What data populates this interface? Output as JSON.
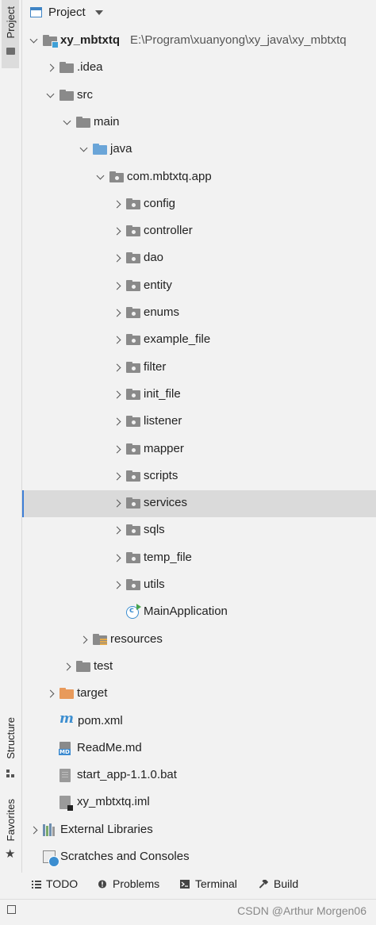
{
  "left_strip": {
    "project_tab": "Project",
    "structure_tab": "Structure",
    "favorites_tab": "Favorites"
  },
  "header": {
    "title": "Project"
  },
  "tree": [
    {
      "label": "xy_mbtxtq",
      "bold": true,
      "path": "E:\\Program\\xuanyong\\xy_java\\xy_mbtxtq",
      "arrow": "down",
      "icon": "module-folder-icon",
      "depth": 0
    },
    {
      "label": ".idea",
      "arrow": "right",
      "icon": "folder-icon",
      "depth": 1
    },
    {
      "label": "src",
      "arrow": "down",
      "icon": "folder-icon",
      "depth": 1
    },
    {
      "label": "main",
      "arrow": "down",
      "icon": "folder-icon",
      "depth": 2
    },
    {
      "label": "java",
      "arrow": "down",
      "icon": "source-folder-icon",
      "depth": 3
    },
    {
      "label": "com.mbtxtq.app",
      "arrow": "down",
      "icon": "package-icon",
      "depth": 4
    },
    {
      "label": "config",
      "arrow": "right",
      "icon": "package-icon",
      "depth": 5
    },
    {
      "label": "controller",
      "arrow": "right",
      "icon": "package-icon",
      "depth": 5
    },
    {
      "label": "dao",
      "arrow": "right",
      "icon": "package-icon",
      "depth": 5
    },
    {
      "label": "entity",
      "arrow": "right",
      "icon": "package-icon",
      "depth": 5
    },
    {
      "label": "enums",
      "arrow": "right",
      "icon": "package-icon",
      "depth": 5
    },
    {
      "label": "example_file",
      "arrow": "right",
      "icon": "package-icon",
      "depth": 5
    },
    {
      "label": "filter",
      "arrow": "right",
      "icon": "package-icon",
      "depth": 5
    },
    {
      "label": "init_file",
      "arrow": "right",
      "icon": "package-icon",
      "depth": 5
    },
    {
      "label": "listener",
      "arrow": "right",
      "icon": "package-icon",
      "depth": 5
    },
    {
      "label": "mapper",
      "arrow": "right",
      "icon": "package-icon",
      "depth": 5
    },
    {
      "label": "scripts",
      "arrow": "right",
      "icon": "package-icon",
      "depth": 5
    },
    {
      "label": "services",
      "arrow": "right",
      "icon": "package-icon",
      "depth": 5,
      "selected": true
    },
    {
      "label": "sqls",
      "arrow": "right",
      "icon": "package-icon",
      "depth": 5
    },
    {
      "label": "temp_file",
      "arrow": "right",
      "icon": "package-icon",
      "depth": 5
    },
    {
      "label": "utils",
      "arrow": "right",
      "icon": "package-icon",
      "depth": 5
    },
    {
      "label": "MainApplication",
      "arrow": "none",
      "icon": "java-class-icon",
      "depth": 5
    },
    {
      "label": "resources",
      "arrow": "right",
      "icon": "resources-folder-icon",
      "depth": 3
    },
    {
      "label": "test",
      "arrow": "right",
      "icon": "folder-icon",
      "depth": 2
    },
    {
      "label": "target",
      "arrow": "right",
      "icon": "excluded-folder-icon",
      "depth": 1
    },
    {
      "label": "pom.xml",
      "arrow": "none",
      "icon": "maven-icon",
      "depth": 1
    },
    {
      "label": "ReadMe.md",
      "arrow": "none",
      "icon": "markdown-file-icon",
      "depth": 1
    },
    {
      "label": "start_app-1.1.0.bat",
      "arrow": "none",
      "icon": "bat-file-icon",
      "depth": 1
    },
    {
      "label": "xy_mbtxtq.iml",
      "arrow": "none",
      "icon": "iml-file-icon",
      "depth": 1
    },
    {
      "label": "External Libraries",
      "arrow": "right",
      "icon": "libraries-icon",
      "depth": 0
    },
    {
      "label": "Scratches and Consoles",
      "arrow": "none",
      "icon": "scratches-icon",
      "depth": 0
    }
  ],
  "bottom_tabs": [
    {
      "label": "TODO",
      "icon": "todo-icon"
    },
    {
      "label": "Problems",
      "icon": "problems-icon"
    },
    {
      "label": "Terminal",
      "icon": "terminal-icon"
    },
    {
      "label": "Build",
      "icon": "build-icon"
    }
  ],
  "watermark": "CSDN @Arthur Morgen06",
  "colors": {
    "selection_bg": "#dadada",
    "selection_accent": "#3d7ed6",
    "source_folder": "#6aa5d8",
    "excluded_folder": "#e89a5b",
    "class_icon": "#3c8ed0"
  }
}
